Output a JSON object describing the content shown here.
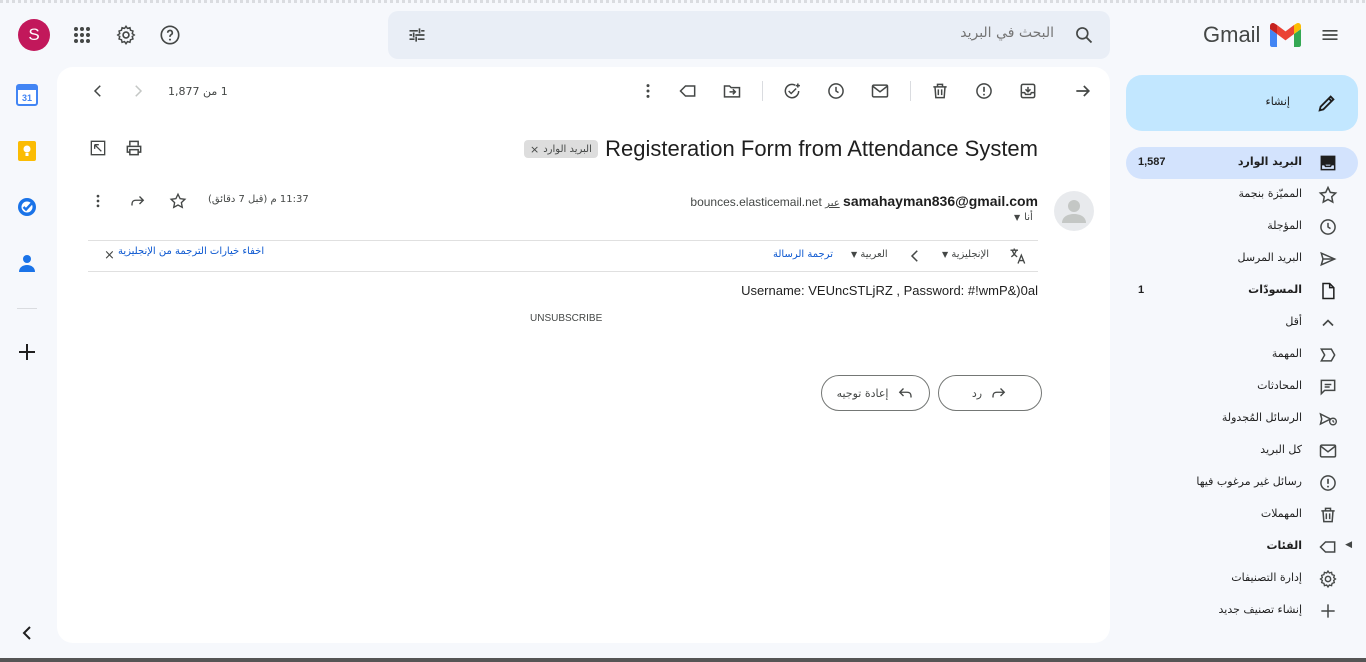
{
  "app": {
    "logo_text": "Gmail",
    "account_initial": "S",
    "search": {
      "placeholder": "البحث في البريد"
    },
    "colors": {
      "accent": "#0b57d0",
      "compose_bg": "#c2e7ff",
      "active_nav_bg": "#d3e3fd",
      "avatar_bg": "#c2185b"
    }
  },
  "sidebar": {
    "compose_label": "إنشاء",
    "items": [
      {
        "label": "البريد الوارد",
        "count": "1,587",
        "icon": "inbox-icon",
        "bold": true,
        "active": true
      },
      {
        "label": "المميّزة بنجمة",
        "count": "",
        "icon": "star-icon"
      },
      {
        "label": "المؤجلة",
        "count": "",
        "icon": "clock-icon"
      },
      {
        "label": "البريد المرسل",
        "count": "",
        "icon": "send-icon"
      },
      {
        "label": "المسودّات",
        "count": "1",
        "icon": "draft-icon",
        "bold": true
      },
      {
        "label": "أقل",
        "count": "",
        "icon": "chevron-up-icon"
      },
      {
        "label": "المهمة",
        "count": "",
        "icon": "important-icon"
      },
      {
        "label": "المحادثات",
        "count": "",
        "icon": "chat-icon"
      },
      {
        "label": "الرسائل المُجدولة",
        "count": "",
        "icon": "scheduled-send-icon"
      },
      {
        "label": "كل البريد",
        "count": "",
        "icon": "all-mail-icon"
      },
      {
        "label": "رسائل غير مرغوب فيها",
        "count": "",
        "icon": "spam-icon"
      },
      {
        "label": "المهملات",
        "count": "",
        "icon": "trash-icon"
      },
      {
        "label": "الفئات",
        "count": "",
        "icon": "label-icon",
        "bold": true
      },
      {
        "label": "إدارة التصنيفات",
        "count": "",
        "icon": "gear-icon"
      },
      {
        "label": "إنشاء تصنيف جديد",
        "count": "",
        "icon": "plus-icon"
      }
    ]
  },
  "toolbar": {
    "page_count": "1 من 1,877"
  },
  "message": {
    "subject": "Registeration Form from Attendance System",
    "label_chip": "البريد الوارد",
    "sender_email": "samahayman836@gmail.com",
    "via_word": "عبر",
    "via_domain": "bounces.elasticemail.net",
    "to_me": "أنا",
    "time": "11:37 م (قبل 7 دقائق)",
    "body": "Username: VEUncSTLjRZ , Password: #!wmP&)0al",
    "unsubscribe": "UNSUBSCRIBE"
  },
  "translate_bar": {
    "from_lang": "الإنجليزية",
    "to_lang": "العربية",
    "translate_link": "ترجمة الرسالة",
    "hide_link": "اخفاء خيارات الترجمة من الإنجليزية"
  },
  "actions": {
    "reply": "رد",
    "forward": "إعادة توجيه"
  }
}
